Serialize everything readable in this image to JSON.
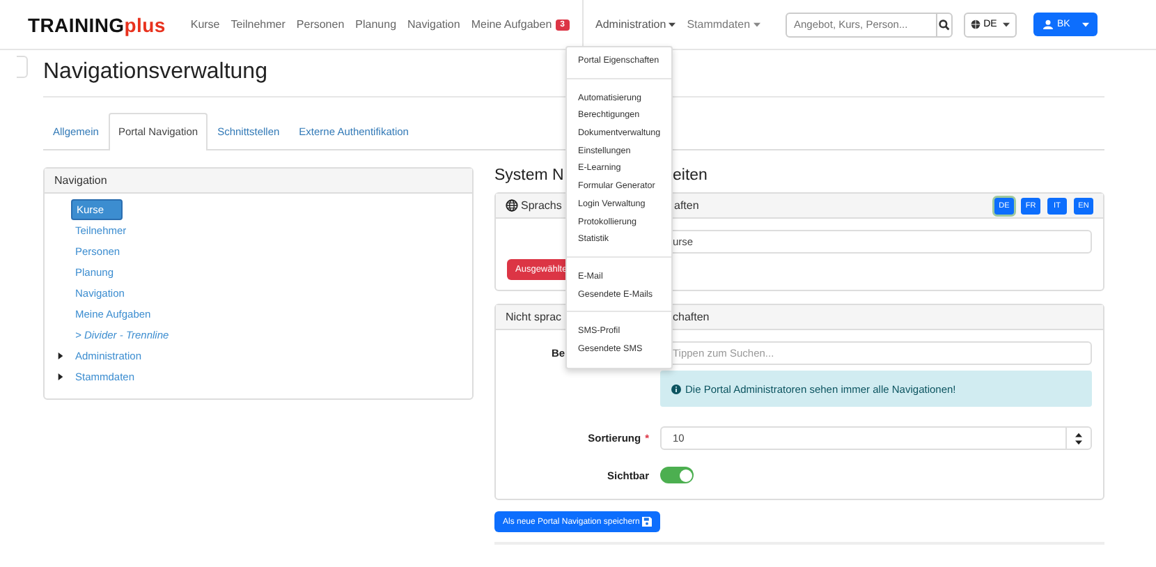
{
  "brand": {
    "main": "TRAINING",
    "accent": "plus"
  },
  "nav_links": [
    {
      "label": "Kurse"
    },
    {
      "label": "Teilnehmer"
    },
    {
      "label": "Personen"
    },
    {
      "label": "Planung"
    },
    {
      "label": "Navigation"
    },
    {
      "label": "Meine Aufgaben",
      "badge": "3"
    }
  ],
  "nav_menus": [
    {
      "label": "Administration",
      "expanded": true
    },
    {
      "label": "Stammdaten",
      "expanded": false
    }
  ],
  "search": {
    "placeholder": "Angebot, Kurs, Person..."
  },
  "language_button": {
    "label": "DE"
  },
  "user_button": {
    "label": "BK"
  },
  "page_title": "Navigationsverwaltung",
  "tabs": [
    {
      "label": "Allgemein",
      "selected": false
    },
    {
      "label": "Portal Navigation",
      "selected": true
    },
    {
      "label": "Schnittstellen",
      "selected": false
    },
    {
      "label": "Externe Authentifikation",
      "selected": false
    }
  ],
  "nav_panel": {
    "title": "Navigation",
    "items": [
      {
        "kind": "link",
        "label": "Kurse",
        "selected": true
      },
      {
        "kind": "link",
        "label": "Teilnehmer",
        "selected": false
      },
      {
        "kind": "link",
        "label": "Personen",
        "selected": false
      },
      {
        "kind": "link",
        "label": "Planung",
        "selected": false
      },
      {
        "kind": "link",
        "label": "Navigation",
        "selected": false
      },
      {
        "kind": "link",
        "label": "Meine Aufgaben",
        "selected": false
      },
      {
        "kind": "divider",
        "label": "> Divider - Trennline",
        "selected": false
      },
      {
        "kind": "group",
        "label": "Administration",
        "selected": false,
        "expanded": false
      },
      {
        "kind": "group",
        "label": "Stammdaten",
        "selected": false,
        "expanded": false
      }
    ]
  },
  "section_title": {
    "left": "System N",
    "right": "eiten"
  },
  "lang_panel": {
    "title_left": "Sprachs",
    "title_right": "aften",
    "languages": [
      {
        "label": "DE",
        "selected": true
      },
      {
        "label": "FR",
        "selected": false
      },
      {
        "label": "IT",
        "selected": false
      },
      {
        "label": "EN",
        "selected": false
      }
    ],
    "name_value": "urse",
    "delete_button": "Ausgewählte"
  },
  "props_panel": {
    "title_left": "Nicht sprac",
    "title_right": "chaften",
    "label_cut": "Be",
    "search_placeholder": "Tippen zum Suchen...",
    "info": "Die Portal Administratoren sehen immer alle Navigationen!",
    "sort_label": "Sortierung",
    "sort_required_mark": "*",
    "sort_value": "10",
    "visible_label": "Sichtbar",
    "visible_on": true
  },
  "save_button": "Als neue Portal Navigation speichern",
  "dropdown": {
    "items": [
      {
        "kind": "item",
        "label": "Portal Eigenschaften"
      },
      {
        "kind": "divider"
      },
      {
        "kind": "item",
        "label": "Automatisierung"
      },
      {
        "kind": "item",
        "label": "Berechtigungen"
      },
      {
        "kind": "item",
        "label": "Dokumentverwaltung"
      },
      {
        "kind": "item",
        "label": "Einstellungen"
      },
      {
        "kind": "item",
        "label": "E-Learning"
      },
      {
        "kind": "item",
        "label": "Formular Generator"
      },
      {
        "kind": "item",
        "label": "Login Verwaltung"
      },
      {
        "kind": "item",
        "label": "Protokollierung"
      },
      {
        "kind": "item",
        "label": "Statistik"
      },
      {
        "kind": "divider"
      },
      {
        "kind": "item",
        "label": "E-Mail"
      },
      {
        "kind": "item",
        "label": "Gesendete E-Mails"
      },
      {
        "kind": "divider"
      },
      {
        "kind": "item",
        "label": "SMS-Profil"
      },
      {
        "kind": "item",
        "label": "Gesendete SMS"
      }
    ]
  }
}
